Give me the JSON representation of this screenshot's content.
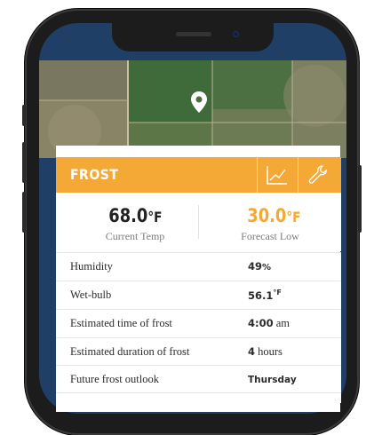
{
  "header": {
    "title": "FROST",
    "chart_icon": "chart-icon",
    "wrench_icon": "wrench-icon"
  },
  "map": {
    "pin_icon": "location-pin-icon"
  },
  "temps": {
    "current": {
      "value": "68.0",
      "unit": "°F",
      "label": "Current Temp"
    },
    "low": {
      "value": "30.0",
      "unit": "°F",
      "label": "Forecast Low"
    }
  },
  "rows": [
    {
      "label": "Humidity",
      "value": "49",
      "unit": "%"
    },
    {
      "label": "Wet-bulb",
      "value": "56.1",
      "unit": "°F"
    },
    {
      "label": "Estimated time of frost",
      "value": "4:00",
      "unit": "am"
    },
    {
      "label": "Estimated duration of frost",
      "value": "4",
      "unit": "hours"
    },
    {
      "label": "Future frost outlook",
      "value": "Thursday",
      "unit": ""
    }
  ],
  "colors": {
    "accent": "#f4a937",
    "screen_bg": "#203f66",
    "text": "#2b2b2b"
  }
}
